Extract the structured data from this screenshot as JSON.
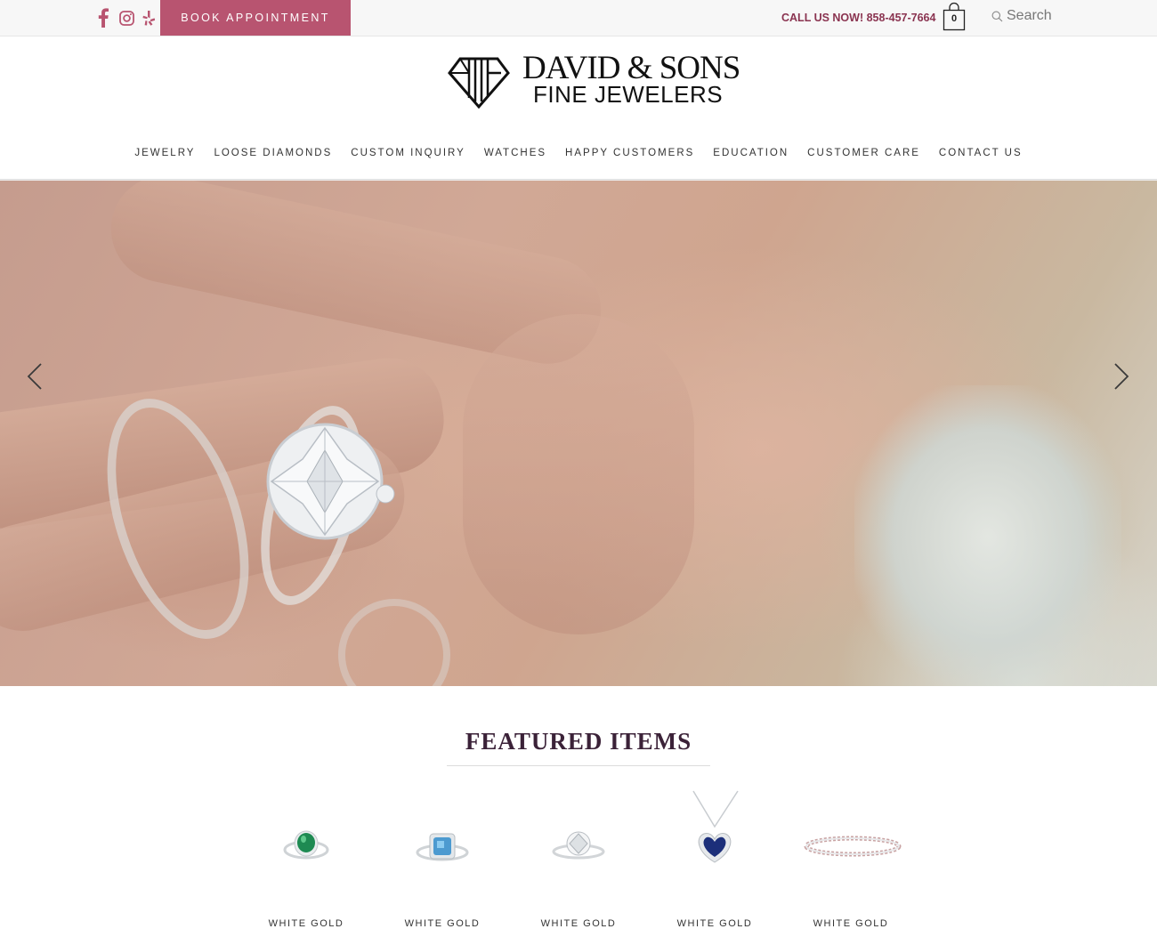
{
  "topbar": {
    "book_label": "BOOK APPOINTMENT",
    "call_text": "CALL US NOW! 858-457-7664",
    "cart_count": "0",
    "search_placeholder": "Search",
    "social_icons": [
      "facebook-icon",
      "instagram-icon",
      "yelp-icon"
    ],
    "accent_color": "#b85470"
  },
  "logo": {
    "line1": "DAVID & SONS",
    "line2": "FINE JEWELERS"
  },
  "nav": {
    "items": [
      "JEWELRY",
      "LOOSE DIAMONDS",
      "CUSTOM INQUIRY",
      "WATCHES",
      "HAPPY CUSTOMERS",
      "EDUCATION",
      "CUSTOMER CARE",
      "CONTACT US"
    ]
  },
  "hero": {
    "prev_icon": "chevron-left-icon",
    "next_icon": "chevron-right-icon"
  },
  "featured": {
    "title": "FEATURED ITEMS",
    "products": [
      {
        "label": "WHITE GOLD",
        "icon": "emerald-ring-icon"
      },
      {
        "label": "WHITE GOLD",
        "icon": "aquamarine-ring-icon"
      },
      {
        "label": "WHITE GOLD",
        "icon": "diamond-ring-icon"
      },
      {
        "label": "WHITE GOLD",
        "icon": "sapphire-heart-pendant-icon"
      },
      {
        "label": "WHITE GOLD",
        "icon": "diamond-bracelet-icon"
      }
    ]
  }
}
